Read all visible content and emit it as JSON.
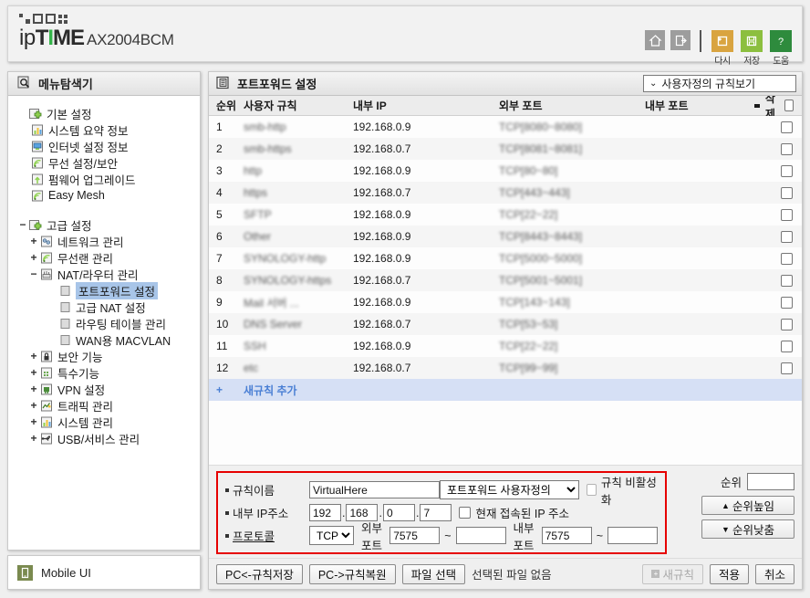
{
  "banner": {
    "logo_ip": "ip",
    "logo_t": "T",
    "logo_i": "I",
    "logo_me": "ME",
    "model": "AX2004BCM",
    "icons": [
      {
        "name": "home-icon",
        "label": ""
      },
      {
        "name": "logout-icon",
        "label": ""
      }
    ],
    "color_buttons": [
      {
        "name": "restart-button",
        "label": "다시",
        "color": "#d9a440"
      },
      {
        "name": "save-button",
        "label": "저장",
        "color": "#8cbf3f"
      },
      {
        "name": "help-button",
        "label": "도움",
        "color": "#2e8b3d"
      }
    ]
  },
  "sidebar": {
    "title": "메뉴탐색기",
    "groups": [
      {
        "label": "기본 설정",
        "expander": "",
        "level": 0,
        "icon": "settings-folder-icon",
        "items": [
          {
            "label": "시스템 요약 정보",
            "icon": "chart-icon"
          },
          {
            "label": "인터넷 설정 정보",
            "icon": "monitor-icon"
          },
          {
            "label": "무선 설정/보안",
            "icon": "wifi-icon"
          },
          {
            "label": "펌웨어 업그레이드",
            "icon": "upgrade-icon"
          },
          {
            "label": "Easy Mesh",
            "icon": "wifi-icon"
          }
        ]
      }
    ],
    "advanced": {
      "label": "고급 설정",
      "expander": "−",
      "icon": "settings-folder-icon",
      "children": [
        {
          "label": "네트워크 관리",
          "expander": "+",
          "icon": "network-icon"
        },
        {
          "label": "무선랜 관리",
          "expander": "+",
          "icon": "wifi-icon"
        },
        {
          "label": "NAT/라우터 관리",
          "expander": "−",
          "icon": "router-icon",
          "subitems": [
            {
              "label": "포트포워드 설정",
              "selected": true
            },
            {
              "label": "고급 NAT 설정",
              "selected": false
            },
            {
              "label": "라우팅 테이블 관리",
              "selected": false
            },
            {
              "label": "WAN용 MACVLAN",
              "selected": false
            }
          ]
        },
        {
          "label": "보안 기능",
          "expander": "+",
          "icon": "lock-icon"
        },
        {
          "label": "특수기능",
          "expander": "+",
          "icon": "grid-icon"
        },
        {
          "label": "VPN 설정",
          "expander": "+",
          "icon": "vpn-icon"
        },
        {
          "label": "트래픽 관리",
          "expander": "+",
          "icon": "traffic-icon"
        },
        {
          "label": "시스템 관리",
          "expander": "+",
          "icon": "chart-icon"
        },
        {
          "label": "USB/서비스 관리",
          "expander": "+",
          "icon": "usb-icon"
        }
      ]
    },
    "mobile_ui": {
      "label": "Mobile UI",
      "icon": "mobile-icon"
    }
  },
  "panel": {
    "title": "포트포워드 설정",
    "title_icon": "clipboard-icon",
    "view_selector": {
      "label": "사용자정의 규칙보기",
      "chevron": "⌄"
    },
    "table": {
      "headers": [
        "순위",
        "사용자 규칙",
        "내부 IP",
        "외부 포트",
        "내부 포트",
        "삭제"
      ],
      "rows": [
        {
          "rank": "1",
          "name": "smb-http",
          "ip": "192.168.0.9",
          "ext": "TCP[8080~8080]",
          "int": "",
          "blurred": true
        },
        {
          "rank": "2",
          "name": "smb-https",
          "ip": "192.168.0.7",
          "ext": "TCP[8081~8081]",
          "int": "",
          "blurred": true
        },
        {
          "rank": "3",
          "name": "http",
          "ip": "192.168.0.9",
          "ext": "TCP[80~80]",
          "int": "",
          "blurred": true
        },
        {
          "rank": "4",
          "name": "https",
          "ip": "192.168.0.7",
          "ext": "TCP[443~443]",
          "int": "",
          "blurred": true
        },
        {
          "rank": "5",
          "name": "SFTP",
          "ip": "192.168.0.9",
          "ext": "TCP[22~22]",
          "int": "",
          "blurred": true
        },
        {
          "rank": "6",
          "name": "Other",
          "ip": "192.168.0.9",
          "ext": "TCP[8443~8443]",
          "int": "",
          "blurred": true
        },
        {
          "rank": "7",
          "name": "SYNOLOGY-http",
          "ip": "192.168.0.9",
          "ext": "TCP[5000~5000]",
          "int": "",
          "blurred": true
        },
        {
          "rank": "8",
          "name": "SYNOLOGY-https",
          "ip": "192.168.0.7",
          "ext": "TCP[5001~5001]",
          "int": "",
          "blurred": true
        },
        {
          "rank": "9",
          "name": "Mail 서버 ...",
          "ip": "192.168.0.9",
          "ext": "TCP[143~143]",
          "int": "",
          "blurred": true
        },
        {
          "rank": "10",
          "name": "DNS Server",
          "ip": "192.168.0.7",
          "ext": "TCP[53~53]",
          "int": "",
          "blurred": true
        },
        {
          "rank": "11",
          "name": "SSH",
          "ip": "192.168.0.9",
          "ext": "TCP[22~22]",
          "int": "",
          "blurred": true
        },
        {
          "rank": "12",
          "name": "etc",
          "ip": "192.168.0.7",
          "ext": "TCP[99~99]",
          "int": "",
          "blurred": true
        }
      ],
      "add_row": {
        "plus": "+",
        "label": "새규칙 추가"
      }
    }
  },
  "form": {
    "rule_name": {
      "label": "규칙이름",
      "value": "VirtualHere"
    },
    "mode_select": {
      "value": "포트포워드 사용자정의"
    },
    "disable_rule": {
      "label": "규칙 비활성화",
      "checked": false
    },
    "internal_ip": {
      "label": "내부 IP주소",
      "o1": "192",
      "o2": "168",
      "o3": "0",
      "o4": "7"
    },
    "current_ip": {
      "label": "현재 접속된 IP 주소",
      "checked": false
    },
    "protocol": {
      "label": "프로토콜",
      "value": "TCP"
    },
    "external_port": {
      "label": "외부 포트",
      "from": "7575",
      "to": ""
    },
    "internal_port": {
      "label": "내부 포트",
      "from": "7575",
      "to": ""
    },
    "border_color": "#e60000"
  },
  "rank_panel": {
    "label": "순위",
    "value": "",
    "up_button": "순위높임",
    "down_button": "순위낮춤",
    "up_arrow": "▲",
    "down_arrow": "▼"
  },
  "button_bar": {
    "save_to_pc": "PC<-규칙저장",
    "restore_from_pc": "PC->규칙복원",
    "choose_file": "파일 선택",
    "no_file": "선택된 파일 없음",
    "new_rule": "새규칙",
    "apply": "적용",
    "cancel": "취소"
  }
}
